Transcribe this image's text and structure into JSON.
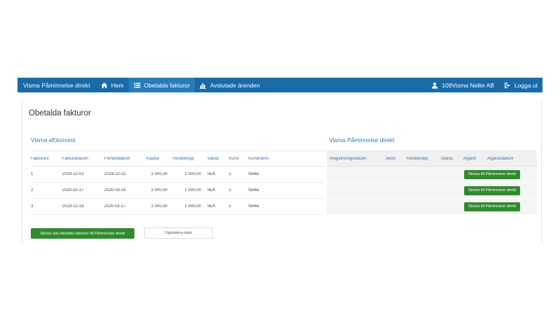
{
  "nav": {
    "brand": "Visma Påminnelse direkt",
    "items": [
      {
        "label": "Hem",
        "icon": "home-icon"
      },
      {
        "label": "Obetalda fakturor",
        "icon": "list-icon"
      },
      {
        "label": "Avslutade ärenden",
        "icon": "bar-chart-icon"
      }
    ],
    "user": {
      "label": "109Visma Nellie AB",
      "icon": "user-icon"
    },
    "logout": {
      "label": "Logga ut",
      "icon": "logout-icon"
    },
    "colors": {
      "bar": "#1a6aa8",
      "active": "#2a7bb8"
    }
  },
  "page": {
    "title": "Obetalda fakturor"
  },
  "left_section": {
    "title": "Visma eEkonomi",
    "columns": [
      "Fakturanr.",
      "Fakturadatum",
      "Förfallodatum",
      "Kapital",
      "Restbelopp",
      "Valuta",
      "Kund",
      "Kundnamn"
    ],
    "rows": [
      [
        "1",
        "2019-12-01",
        "2019-12-31",
        "1 000,00",
        "1 000,00",
        "SEK",
        "1",
        "Nellie"
      ],
      [
        "2",
        "2020-02-17",
        "2020-03-18",
        "1 000,00",
        "1 000,00",
        "SEK",
        "1",
        "Nellie"
      ],
      [
        "3",
        "2019-12-18",
        "2020-01-17",
        "1 000,00",
        "1 000,00",
        "SEK",
        "1",
        "Nellie"
      ]
    ]
  },
  "right_section": {
    "title": "Visma Påminnelse direkt",
    "columns": [
      "Registreringsdatum",
      "Aktnr.",
      "Restbelopp",
      "Status",
      "Åtgärd",
      "Åtgärdsdatum"
    ],
    "row_button_label": "Skicka till Påminnelse direkt"
  },
  "actions": {
    "send_all_label": "Skicka alla obetalda fakturor till Påminnelse direkt",
    "update_label": "Uppdatera data"
  },
  "colors": {
    "accent": "#2a7bb8",
    "button_green": "#2e8b2e"
  }
}
